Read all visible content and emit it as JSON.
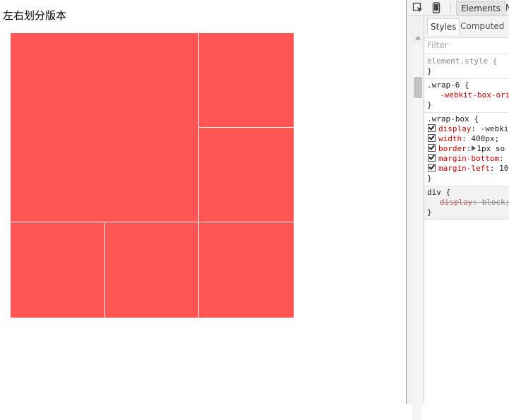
{
  "page": {
    "title": "左右划分版本",
    "cell_color": "#ff5555"
  },
  "devtools": {
    "toolbar": {
      "inspect_icon": "inspect-element-icon",
      "device_icon": "device-mode-icon",
      "tab_elements": "Elements",
      "tab_more": "N"
    },
    "styles_tabs": {
      "styles": "Styles",
      "computed": "Computed"
    },
    "filter": {
      "placeholder": "Filter",
      "value": ""
    },
    "rules": [
      {
        "selector": "element.style {",
        "close": "}"
      },
      {
        "selector": ".wrap-6 {",
        "decls": [
          {
            "prop": "-webkit-box-ori",
            "val": ""
          }
        ],
        "close": "}"
      },
      {
        "selector": ".wrap-box {",
        "decls": [
          {
            "prop": "display",
            "val": "-webki"
          },
          {
            "prop": "width",
            "val": "400px;"
          },
          {
            "prop": "border",
            "val": "1px so"
          },
          {
            "prop": "margin-bottom",
            "val": ""
          },
          {
            "prop": "margin-left",
            "val": "10"
          }
        ],
        "close": "}"
      },
      {
        "selector": "div {",
        "decls": [
          {
            "prop": "display",
            "val": "block;"
          }
        ],
        "close": "}"
      }
    ]
  }
}
